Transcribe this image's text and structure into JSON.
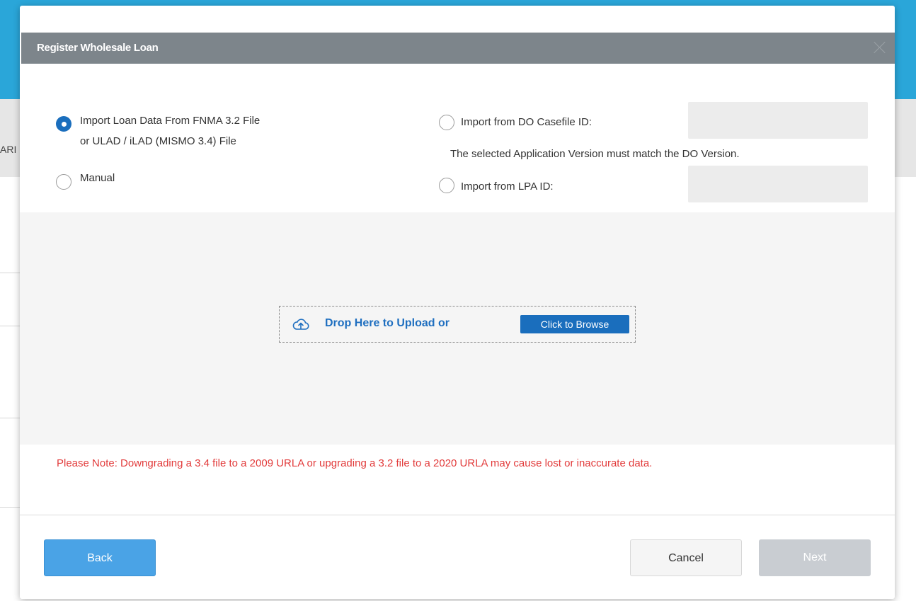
{
  "background": {
    "left_fragment": "ARI"
  },
  "modal": {
    "title": "Register Wholesale Loan",
    "options": {
      "import_fnma_line1": "Import Loan Data From FNMA 3.2 File",
      "import_fnma_line2": "or ULAD / iLAD (MISMO 3.4) File",
      "import_fnma_checked": true,
      "manual": "Manual",
      "manual_checked": false,
      "do_casefile": "Import from DO Casefile ID:",
      "do_casefile_checked": false,
      "do_casefile_value": "",
      "do_version_note": "The selected Application Version must match the DO Version.",
      "lpa": "Import from LPA ID:",
      "lpa_checked": false,
      "lpa_value": ""
    },
    "upload": {
      "icon": "cloud-upload-icon",
      "drop_text": "Drop Here to Upload or",
      "browse_label": "Click to Browse"
    },
    "note": "Please Note: Downgrading a 3.4 file to a 2009 URLA or upgrading a 3.2 file to a 2020 URLA may cause lost or inaccurate data.",
    "buttons": {
      "back": "Back",
      "cancel": "Cancel",
      "next": "Next"
    }
  },
  "colors": {
    "header": "#7d858b",
    "primary": "#1a6ebd",
    "note": "#e23b3b",
    "page_top": "#2aa6d9"
  }
}
